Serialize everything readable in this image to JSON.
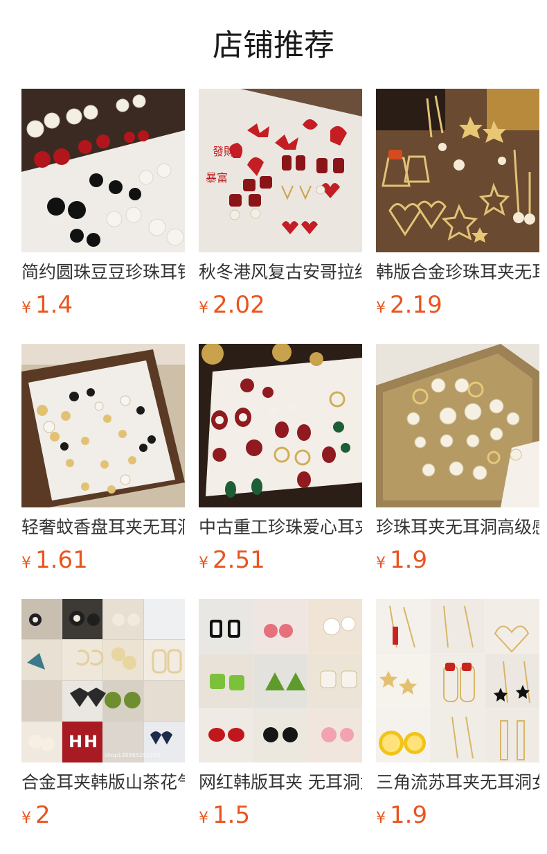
{
  "header": {
    "title": "店铺推荐"
  },
  "currency_symbol": "¥",
  "products": [
    {
      "name": "简约圆珠豆豆珍珠耳钉",
      "price": "1.4",
      "bg": "#c9c3bb"
    },
    {
      "name": "秋冬港风复古安哥拉红色",
      "price": "2.02",
      "bg": "#e9e4dc"
    },
    {
      "name": "韩版合金珍珠耳夹无耳洞",
      "price": "2.19",
      "bg": "#6b4a30"
    },
    {
      "name": "轻奢蚊香盘耳夹无耳洞",
      "price": "1.61",
      "bg": "#a08d75"
    },
    {
      "name": "中古重工珍珠爱心耳夹",
      "price": "2.51",
      "bg": "#3a2a20"
    },
    {
      "name": "珍珠耳夹无耳洞高级感",
      "price": "1.9",
      "bg": "#b39a6a"
    },
    {
      "name": "合金耳夹韩版山茶花气质",
      "price": "2",
      "bg": "#d8d2c8",
      "watermark": "shop139585281323"
    },
    {
      "name": "网红韩版耳夹 无耳洞女",
      "price": "1.5",
      "bg": "#eceae6"
    },
    {
      "name": "三角流苏耳夹无耳洞女",
      "price": "1.9",
      "bg": "#f2efea"
    }
  ]
}
